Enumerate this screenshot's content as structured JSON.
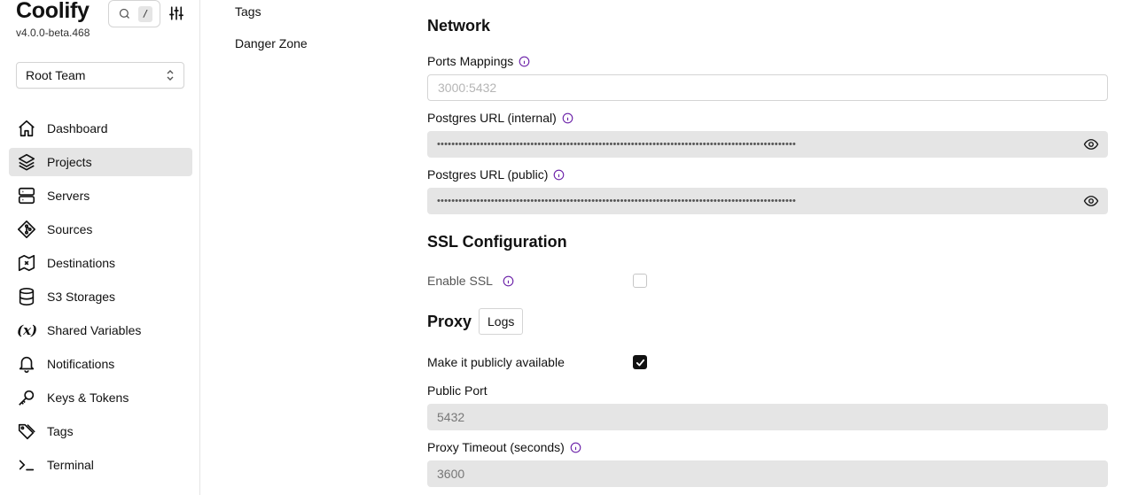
{
  "app": {
    "title": "Coolify",
    "version": "v4.0.0-beta.468"
  },
  "search": {
    "shortcut": "/"
  },
  "team_select": {
    "value": "Root Team"
  },
  "sidebar": {
    "items": [
      {
        "label": "Dashboard",
        "icon": "home-icon"
      },
      {
        "label": "Projects",
        "icon": "layers-icon",
        "active": true
      },
      {
        "label": "Servers",
        "icon": "server-icon"
      },
      {
        "label": "Sources",
        "icon": "git-icon"
      },
      {
        "label": "Destinations",
        "icon": "map-icon"
      },
      {
        "label": "S3 Storages",
        "icon": "database-icon"
      },
      {
        "label": "Shared Variables",
        "icon": "variable-icon"
      },
      {
        "label": "Notifications",
        "icon": "bell-icon"
      },
      {
        "label": "Keys & Tokens",
        "icon": "key-icon"
      },
      {
        "label": "Tags",
        "icon": "tag-icon"
      },
      {
        "label": "Terminal",
        "icon": "terminal-icon"
      }
    ]
  },
  "subnav": {
    "items": [
      "Tags",
      "Danger Zone"
    ]
  },
  "network": {
    "heading": "Network",
    "ports_label": "Ports Mappings",
    "ports_placeholder": "3000:5432",
    "internal_label": "Postgres URL (internal)",
    "internal_value": "••••••••••••••••••••••••••••••••••••••••••••••••••••••••••••••••••••••••••••••••••••••••••••••••••••",
    "public_label": "Postgres URL (public)",
    "public_value": "••••••••••••••••••••••••••••••••••••••••••••••••••••••••••••••••••••••••••••••••••••••••••••••••••••"
  },
  "ssl": {
    "heading": "SSL Configuration",
    "enable_label": "Enable SSL",
    "enabled": false
  },
  "proxy": {
    "heading": "Proxy",
    "logs_label": "Logs",
    "public_label": "Make it publicly available",
    "public_enabled": true,
    "port_label": "Public Port",
    "port_value": "5432",
    "timeout_label": "Proxy Timeout (seconds)",
    "timeout_value": "3600"
  },
  "colors": {
    "accent": "#6b21a8",
    "active_bg": "#e5e5e5"
  }
}
